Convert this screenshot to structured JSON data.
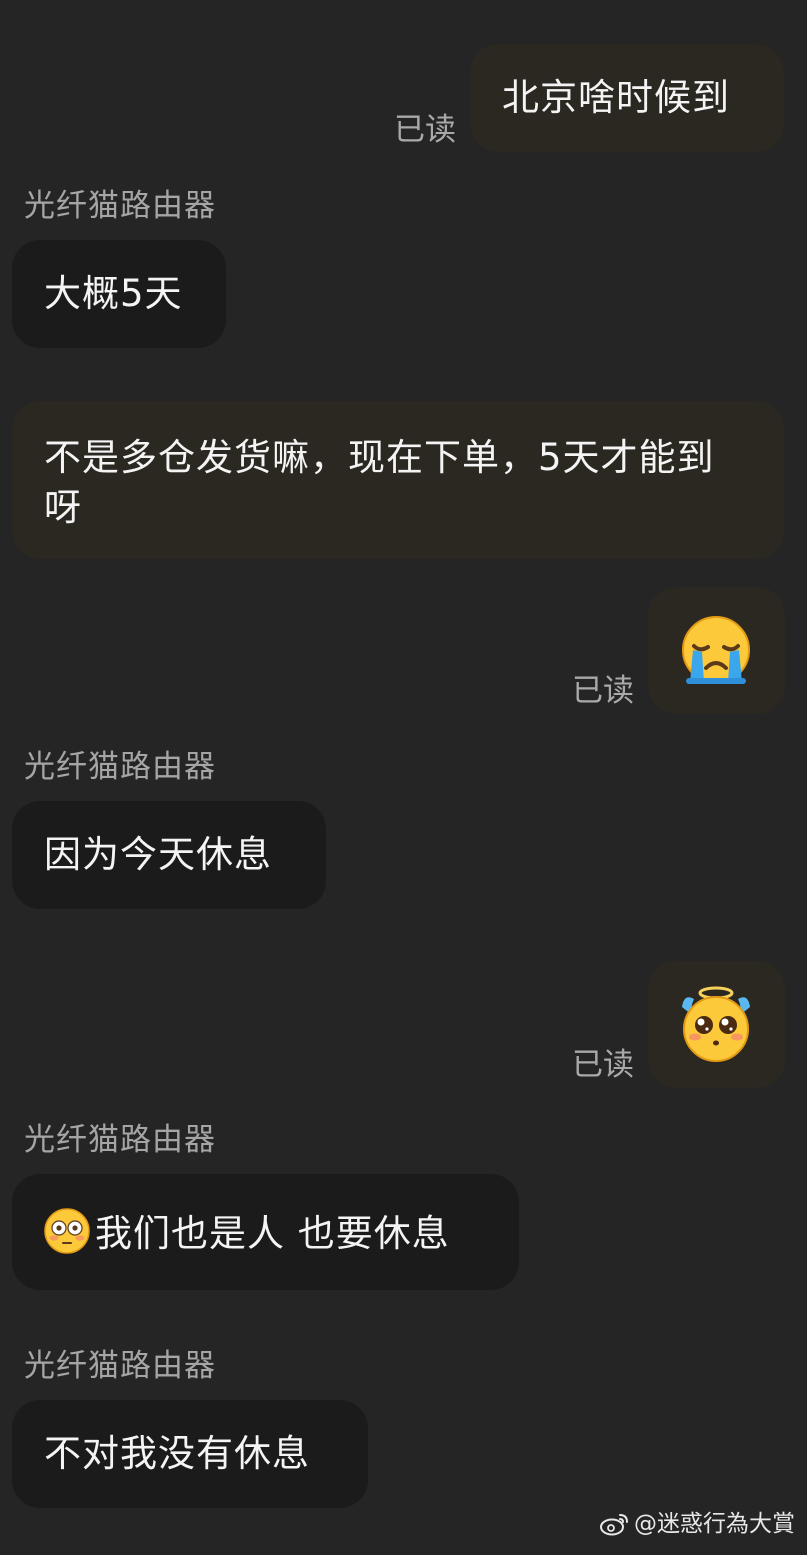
{
  "read_label": "已读",
  "sender_name": "光纤猫路由器",
  "messages": [
    {
      "text": "北京啥时候到"
    },
    {
      "text": "大概5天"
    },
    {
      "text": "不是多仓发货嘛，现在下单，5天才能到呀"
    },
    {
      "emoji": "crying-face-emoji"
    },
    {
      "text": "因为今天休息"
    },
    {
      "emoji": "angel-pleading-face-emoji"
    },
    {
      "text": "我们也是人 也要休息",
      "leading_emoji": "flushed-face-emoji"
    },
    {
      "text": "不对我没有休息"
    }
  ],
  "watermark": {
    "icon": "weibo-icon",
    "text": "@迷惑行為大賞"
  },
  "colors": {
    "background": "#252525",
    "outgoing_bubble": "#2b2721",
    "incoming_bubble": "#1b1b1b",
    "read_label": "#a9a9a9",
    "sender_name": "#a5a5a5"
  }
}
